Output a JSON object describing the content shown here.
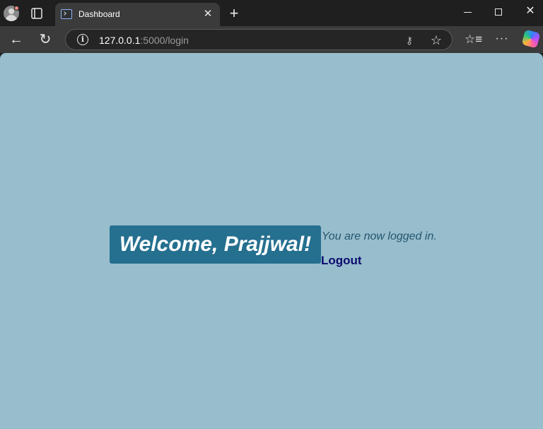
{
  "browser": {
    "tab": {
      "title": "Dashboard"
    },
    "address": {
      "host": "127.0.0.1",
      "rest": ":5000/login"
    }
  },
  "icons": {
    "profile": "profile-avatar-icon",
    "tab_actions": "tab-actions-icon",
    "favicon": "terminal-favicon-icon",
    "tab_close": "close-icon",
    "new_tab": "plus-icon",
    "back": "arrow-left-icon",
    "reload": "reload-icon",
    "info": "info-icon",
    "key": "key-icon",
    "favorite": "star-icon",
    "favorites": "favorites-list-icon",
    "more": "more-icon",
    "copilot": "copilot-icon"
  },
  "page": {
    "welcome": "Welcome, Prajjwal!",
    "status": "You are now logged in.",
    "logout": "Logout"
  },
  "colors": {
    "page_background": "#98bdcd",
    "welcome_background": "#256f8f",
    "status_text": "#24566e",
    "logout_text": "#0b0b6e"
  }
}
